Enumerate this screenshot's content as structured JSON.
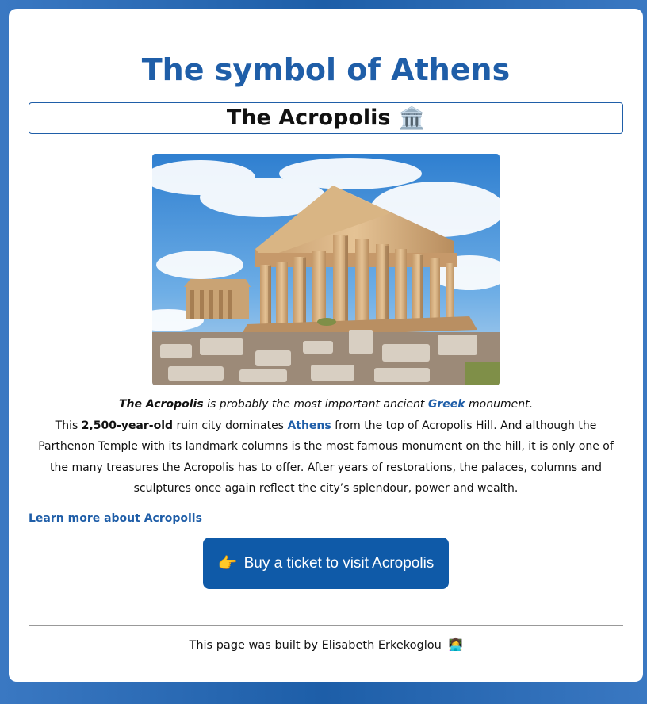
{
  "page": {
    "title": "The symbol of Athens",
    "subtitle": "The Acropolis",
    "subtitle_icon": "🏛️",
    "subtitle_icon_name": "classical-building-icon"
  },
  "image": {
    "alt": "Parthenon on the Acropolis hill"
  },
  "description": {
    "line1": {
      "name": "The Acropolis",
      "text_a": " is probably the most important ancient ",
      "link": "Greek",
      "text_b": " monument."
    },
    "line2": {
      "text_a": "This ",
      "bold": "2,500-year-old",
      "text_b": " ruin city dominates ",
      "link": "Athens",
      "text_c": " from the top of Acropolis Hill. And although the Parthenon Temple with its landmark columns is the most famous monument on the hill, it is only one of the many treasures the Acropolis has to offer. After years of restorations, the palaces, columns and sculptures once again reflect the city’s splendour, power and wealth."
    }
  },
  "links": {
    "learn_more": "Learn more about Acropolis"
  },
  "cta": {
    "icon": "👉",
    "icon_name": "pointing-hand-icon",
    "label": "Buy a ticket to visit Acropolis"
  },
  "footer": {
    "text": "This page was built by Elisabeth Erkekoglou",
    "icon": "👩‍💻",
    "icon_name": "woman-technologist-icon"
  },
  "colors": {
    "accent": "#1f5ea8",
    "button": "#0f5aa8",
    "background": "#2d6bb5"
  }
}
